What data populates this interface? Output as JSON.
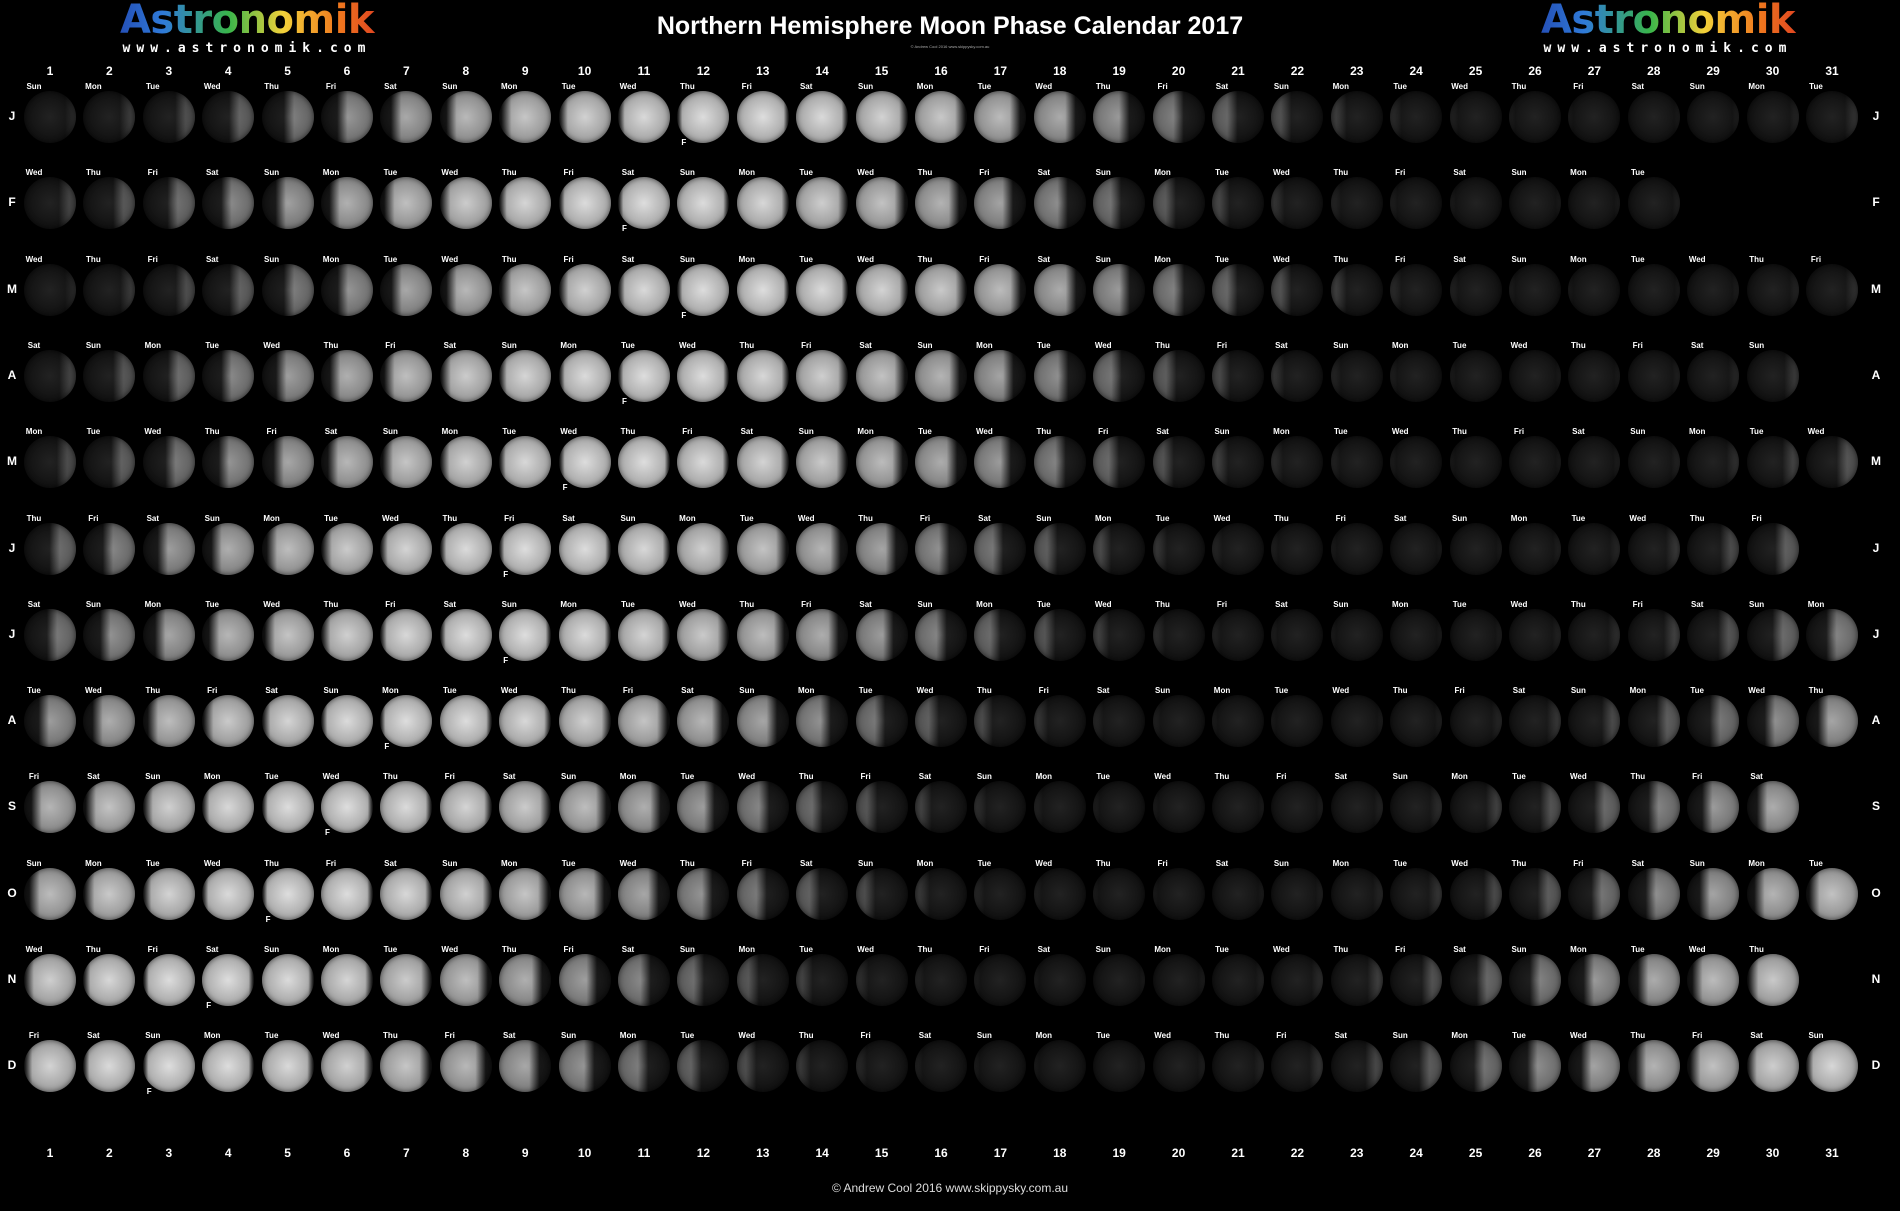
{
  "title": "Northern Hemisphere Moon Phase Calendar 2017",
  "subcredit": "© Andrew Cool  2016  www.skippysky.com.au",
  "logo": {
    "word": "Astronomik",
    "url": "www.astronomik.com"
  },
  "footer": "© Andrew Cool    2016   www.skippysky.com.au",
  "day_numbers": [
    "1",
    "2",
    "3",
    "4",
    "5",
    "6",
    "7",
    "8",
    "9",
    "10",
    "11",
    "12",
    "13",
    "14",
    "15",
    "16",
    "17",
    "18",
    "19",
    "20",
    "21",
    "22",
    "23",
    "24",
    "25",
    "26",
    "27",
    "28",
    "29",
    "30",
    "31"
  ],
  "full_moon_mark": "F",
  "months": [
    {
      "letter": "J",
      "days": 31,
      "first_weekday": "Sun",
      "full_moon_day": 12
    },
    {
      "letter": "F",
      "days": 28,
      "first_weekday": "Wed",
      "full_moon_day": 11
    },
    {
      "letter": "M",
      "days": 31,
      "first_weekday": "Wed",
      "full_moon_day": 12
    },
    {
      "letter": "A",
      "days": 30,
      "first_weekday": "Sat",
      "full_moon_day": 11
    },
    {
      "letter": "M",
      "days": 31,
      "first_weekday": "Mon",
      "full_moon_day": 10
    },
    {
      "letter": "J",
      "days": 30,
      "first_weekday": "Thu",
      "full_moon_day": 9
    },
    {
      "letter": "J",
      "days": 31,
      "first_weekday": "Sat",
      "full_moon_day": 9
    },
    {
      "letter": "A",
      "days": 31,
      "first_weekday": "Tue",
      "full_moon_day": 7
    },
    {
      "letter": "S",
      "days": 30,
      "first_weekday": "Fri",
      "full_moon_day": 6
    },
    {
      "letter": "O",
      "days": 31,
      "first_weekday": "Sun",
      "full_moon_day": 5
    },
    {
      "letter": "N",
      "days": 30,
      "first_weekday": "Wed",
      "full_moon_day": 4
    },
    {
      "letter": "D",
      "days": 31,
      "first_weekday": "Fri",
      "full_moon_day": 3
    }
  ],
  "weekdays": [
    "Sun",
    "Mon",
    "Tue",
    "Wed",
    "Thu",
    "Fri",
    "Sat"
  ],
  "colors": {
    "background": "#000000",
    "text": "#ffffff",
    "moon_lit": "#d8d8d8",
    "moon_dark": "#1c1c1c"
  }
}
